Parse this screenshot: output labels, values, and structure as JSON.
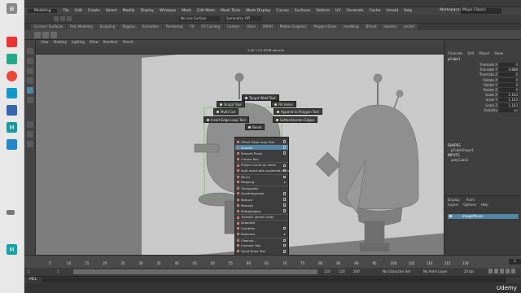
{
  "menubar": {
    "mode": "Modeling",
    "items": [
      "File",
      "Edit",
      "Create",
      "Select",
      "Modify",
      "Display",
      "Windows",
      "Mesh",
      "Edit Mesh",
      "Mesh Tools",
      "Mesh Display",
      "Curves",
      "Surfaces",
      "Deform",
      "UV",
      "Generate",
      "Cache",
      "Arnold",
      "Help"
    ],
    "workspace_label": "Workspace:",
    "workspace_value": "Maya Classic"
  },
  "statusline": {
    "symmetry": "No Live Surface",
    "symmetry_off": "Symmetry: Off"
  },
  "shelf_tabs": [
    "Curves / Surfaces",
    "Poly Modeling",
    "Sculpting",
    "Rigging",
    "Animation",
    "Rendering",
    "FX",
    "FX Caching",
    "Custom",
    "XGen",
    "MASH",
    "Motion Graphics",
    "Polygon Draw",
    "modeling",
    "Bifrost",
    "lookdev",
    "arnold"
  ],
  "viewport": {
    "menu": [
      "View",
      "Shading",
      "Lighting",
      "Show",
      "Renderer",
      "Panels"
    ],
    "camera_info": "0.00  1.00  sRGB gamma"
  },
  "hotbox": {
    "target_weld": "Target Weld Tool",
    "sculpt": "Sculpt Tool",
    "fill_holes": "Fill Holes",
    "multi_cut": "Multi-Cut",
    "append_polygon": "Append to Polygon Tool",
    "insert_edge_loop": "Insert Edge Loop Tool",
    "soften_harden": "Soften/Harden Edges",
    "bevel": "Bevel"
  },
  "context_menu": [
    {
      "label": "Offset Edge Loop Tool",
      "box": true
    },
    {
      "label": "Smooth",
      "box": true,
      "selected": true
    },
    {
      "label": "Smooth Proxy",
      "box": true
    },
    {
      "label": "Crease Tool",
      "box": false
    },
    {
      "label": "Project Curve on mesh",
      "box": true,
      "sep": true
    },
    {
      "label": "Split mesh with projected curve",
      "box": true
    },
    {
      "label": "Mirror",
      "box": true,
      "sep": true
    },
    {
      "label": "Mapping",
      "arrow": true
    },
    {
      "label": "Triangulate",
      "box": false,
      "sep": true
    },
    {
      "label": "Quadrangulate",
      "box": true
    },
    {
      "label": "Reduce",
      "box": true
    },
    {
      "label": "Remesh",
      "box": true
    },
    {
      "label": "Retopologize",
      "box": true
    },
    {
      "label": "Transfer Vertex Order",
      "box": false,
      "sep": true
    },
    {
      "label": "Separate",
      "box": false,
      "sep": true
    },
    {
      "label": "Combine",
      "box": true
    },
    {
      "label": "Booleans",
      "arrow": true
    },
    {
      "label": "Cleanup...",
      "box": true,
      "sep": true
    },
    {
      "label": "Connect Tool",
      "box": true
    },
    {
      "label": "Quad Draw Tool",
      "box": true
    },
    {
      "label": "Polygon Display",
      "arrow": true,
      "sep": true
    }
  ],
  "channelbox": {
    "tabs": [
      "Channels",
      "Edit",
      "Object",
      "Show"
    ],
    "object_name": "pCube1",
    "attrs": [
      {
        "name": "Translate X",
        "value": "0"
      },
      {
        "name": "Translate Y",
        "value": "4.888"
      },
      {
        "name": "Translate Z",
        "value": "0"
      },
      {
        "name": "Rotate X",
        "value": "0"
      },
      {
        "name": "Rotate Y",
        "value": "0"
      },
      {
        "name": "Rotate Z",
        "value": "0"
      },
      {
        "name": "Scale X",
        "value": "1.163"
      },
      {
        "name": "Scale Y",
        "value": "1.163"
      },
      {
        "name": "Scale Z",
        "value": "1.163"
      },
      {
        "name": "Visibility",
        "value": "on"
      }
    ],
    "shapes_header": "SHAPES",
    "shape_name": "pCubeShape1",
    "inputs_header": "INPUTS",
    "input_name": "polyCube1"
  },
  "layers": {
    "tabs": [
      "Display",
      "Anim"
    ],
    "menu": [
      "Layers",
      "Options",
      "Help"
    ],
    "layer_name": "ImagePlanes"
  },
  "timeslider": {
    "ticks": [
      "5",
      "10",
      "15",
      "20",
      "25",
      "30",
      "35",
      "40",
      "45",
      "50",
      "55",
      "60",
      "65",
      "70",
      "75",
      "80",
      "85",
      "90",
      "95",
      "100",
      "105",
      "110",
      "115",
      "120"
    ],
    "current_frame": "1"
  },
  "rangeslider": {
    "start": "1",
    "range_start": "1",
    "range_end": "120",
    "end": "120",
    "end2": "200",
    "char_set": "No Character Set",
    "anim_layer": "No Anim Layer",
    "fps": "24 fps"
  },
  "cmdline": {
    "label": "MEL"
  },
  "udemy": "Udemy"
}
